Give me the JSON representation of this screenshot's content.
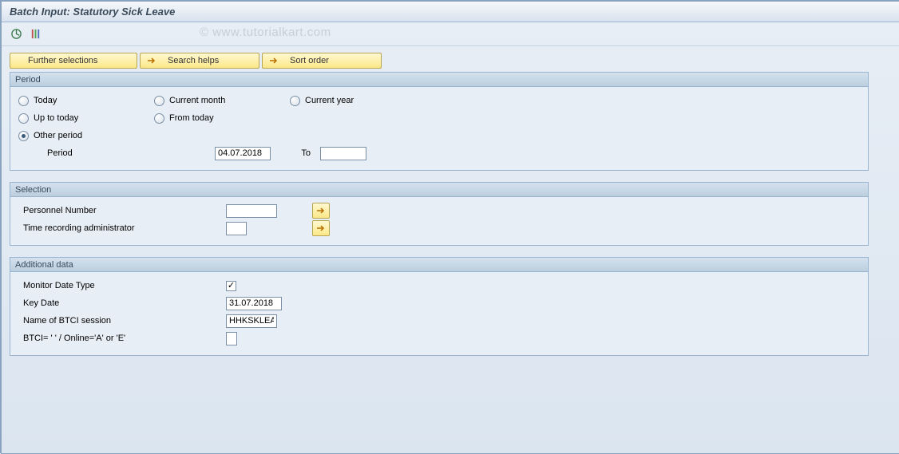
{
  "title": "Batch Input: Statutory Sick Leave",
  "watermark": "© www.tutorialkart.com",
  "buttons": {
    "further_selections": "Further selections",
    "search_helps": "Search helps",
    "sort_order": "Sort order"
  },
  "period": {
    "header": "Period",
    "today": "Today",
    "current_month": "Current month",
    "current_year": "Current year",
    "up_to_today": "Up to today",
    "from_today": "From today",
    "other_period": "Other period",
    "period_label": "Period",
    "period_from": "04.07.2018",
    "to_label": "To",
    "period_to": ""
  },
  "selection": {
    "header": "Selection",
    "personnel_number": "Personnel Number",
    "personnel_number_val": "",
    "time_admin": "Time recording administrator",
    "time_admin_val": ""
  },
  "additional": {
    "header": "Additional data",
    "monitor_date_type": "Monitor Date Type",
    "monitor_checked": true,
    "key_date": "Key Date",
    "key_date_val": "31.07.2018",
    "btci_name": "Name of BTCI session",
    "btci_name_val": "HHKSKLEA",
    "btci_mode": "BTCI= ' ' / Online='A' or 'E'",
    "btci_mode_val": ""
  }
}
